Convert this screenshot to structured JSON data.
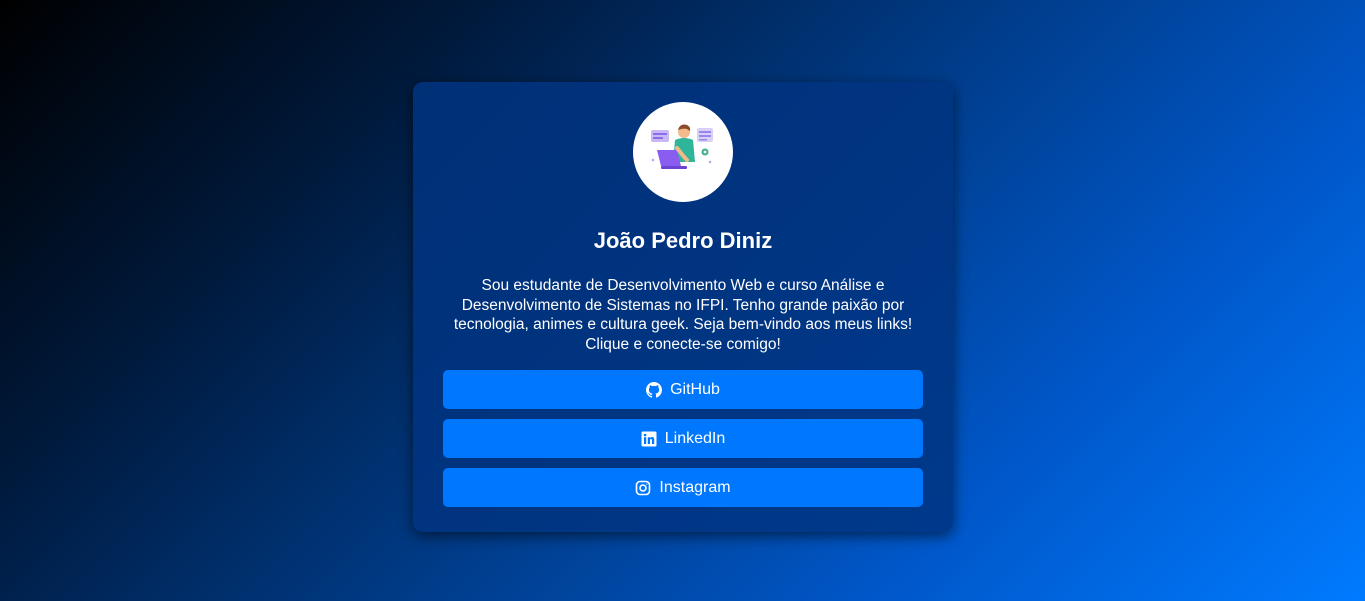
{
  "profile": {
    "name": "João Pedro Diniz",
    "bio": "Sou estudante de Desenvolvimento Web e curso Análise e Desenvolvimento de Sistemas no IFPI. Tenho grande paixão por tecnologia, animes e cultura geek. Seja bem-vindo aos meus links! Clique e conecte-se comigo!",
    "avatar_icon": "developer-illustration"
  },
  "links": [
    {
      "label": "GitHub",
      "icon": "github-icon"
    },
    {
      "label": "LinkedIn",
      "icon": "linkedin-icon"
    },
    {
      "label": "Instagram",
      "icon": "instagram-icon"
    }
  ],
  "colors": {
    "card_background": "#003480",
    "button_background": "#0077ff",
    "text": "#ffffff",
    "gradient_start": "#000000",
    "gradient_end": "#007bff"
  }
}
